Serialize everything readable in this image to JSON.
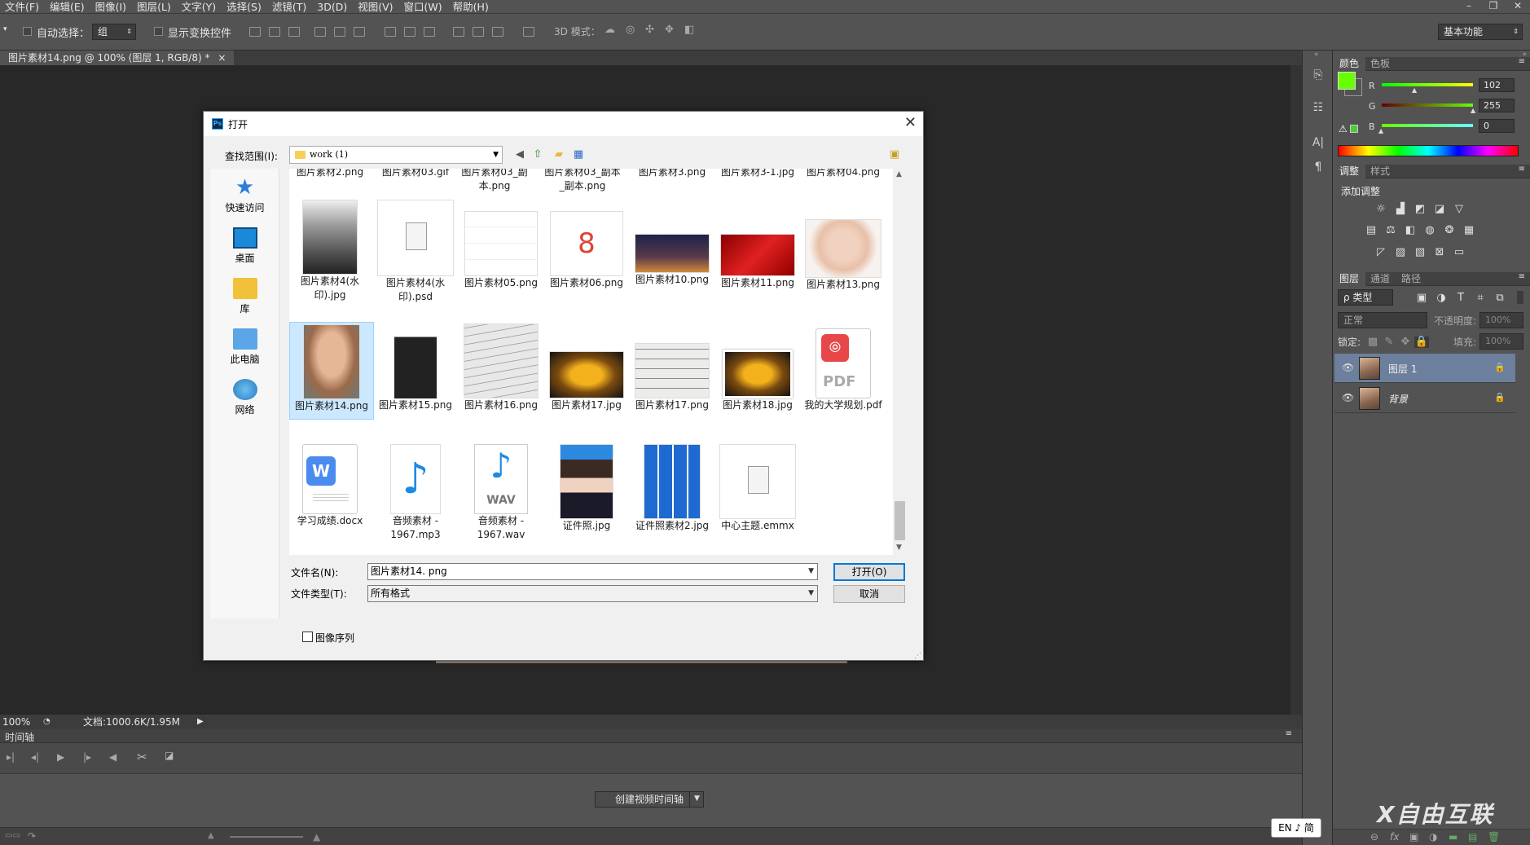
{
  "menu": [
    "文件(F)",
    "编辑(E)",
    "图像(I)",
    "图层(L)",
    "文字(Y)",
    "选择(S)",
    "滤镜(T)",
    "3D(D)",
    "视图(V)",
    "窗口(W)",
    "帮助(H)"
  ],
  "options": {
    "auto_select_label": "自动选择：",
    "auto_select_value": "组",
    "show_transform_label": "显示变换控件",
    "mode3d_label": "3D 模式：",
    "workspace": "基本功能"
  },
  "doc_tab": {
    "title": "图片素材14.png @ 100% (图层 1, RGB/8) *",
    "close": "×"
  },
  "status": {
    "zoom": "100%",
    "doc_info": "文档:1000.6K/1.95M"
  },
  "timeline": {
    "title": "时间轴",
    "create_button": "创建视频时间轴"
  },
  "color_panel": {
    "tabs": [
      "颜色",
      "色板"
    ],
    "fg_color": "#66ff00",
    "r_label": "R",
    "g_label": "G",
    "b_label": "B",
    "r": "102",
    "g": "255",
    "b": "0"
  },
  "adjust_panel": {
    "tabs": [
      "调整",
      "样式"
    ],
    "title": "添加调整"
  },
  "layers_panel": {
    "tabs": [
      "图层",
      "通道",
      "路径"
    ],
    "filter_label": "ρ 类型",
    "blend_mode": "正常",
    "opacity_label": "不透明度:",
    "opacity_value": "100%",
    "lock_label": "锁定:",
    "fill_label": "填充:",
    "fill_value": "100%",
    "layers": [
      {
        "name": "图层 1",
        "selected": true
      },
      {
        "name": "背景",
        "selected": false
      }
    ]
  },
  "dialog": {
    "title": "打开",
    "look_in_label": "查找范围(I):",
    "look_in_value": "work (1)",
    "places": [
      "快速访问",
      "桌面",
      "库",
      "此电脑",
      "网络"
    ],
    "top_row": [
      "图片素材2.png",
      "图片素材03.gif",
      "图片素材03_副本.png",
      "图片素材03_副本_副本.png",
      "图片素材3.png",
      "图片素材3-1.jpg",
      "图片素材04.png"
    ],
    "row1": [
      "图片素材4(水印).jpg",
      "图片素材4(水印).psd",
      "图片素材05.png",
      "图片素材06.png",
      "图片素材10.png",
      "图片素材11.png",
      "图片素材13.png"
    ],
    "row2": [
      "图片素材14.png",
      "图片素材15.png",
      "图片素材16.png",
      "图片素材17.jpg",
      "图片素材17.png",
      "图片素材18.jpg",
      "我的大学规划.pdf"
    ],
    "row3": [
      "学习成绩.docx",
      "音频素材 - 1967.mp3",
      "音频素材 - 1967.wav",
      "证件照.jpg",
      "证件照素材2.jpg",
      "中心主题.emmx"
    ],
    "filename_label": "文件名(N):",
    "filename_value": "图片素材14. png",
    "filetype_label": "文件类型(T):",
    "filetype_value": "所有格式",
    "open_button": "打开(O)",
    "cancel_button": "取消",
    "image_sequence": "图像序列",
    "pdf_text": "PDF",
    "wav_text": "WAV"
  },
  "ime": "EN ♪ 简",
  "watermark": "X自由互联"
}
